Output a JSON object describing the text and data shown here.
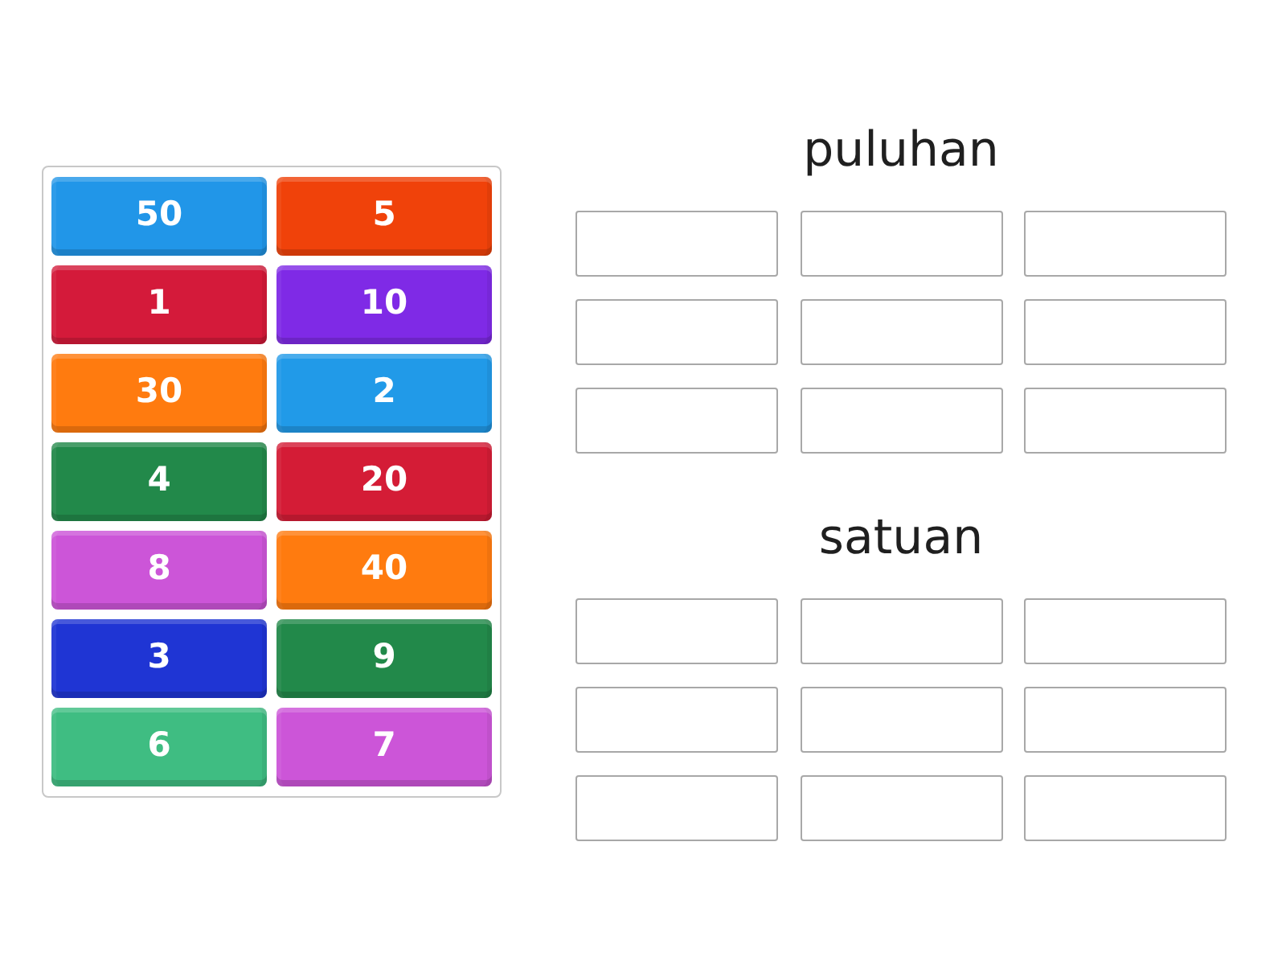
{
  "tiles": [
    {
      "label": "50",
      "color": "#2196e8"
    },
    {
      "label": "5",
      "color": "#f0420a"
    },
    {
      "label": "1",
      "color": "#d41a3a"
    },
    {
      "label": "10",
      "color": "#7f2ae6"
    },
    {
      "label": "30",
      "color": "#ff7b0f"
    },
    {
      "label": "2",
      "color": "#219ae8"
    },
    {
      "label": "4",
      "color": "#22894a"
    },
    {
      "label": "20",
      "color": "#d41c36"
    },
    {
      "label": "8",
      "color": "#cc55d8"
    },
    {
      "label": "40",
      "color": "#ff7b0f"
    },
    {
      "label": "3",
      "color": "#1f35d4"
    },
    {
      "label": "9",
      "color": "#22894a"
    },
    {
      "label": "6",
      "color": "#3fbd82"
    },
    {
      "label": "7",
      "color": "#cc55d8"
    }
  ],
  "groups": [
    {
      "title": "puluhan"
    },
    {
      "title": "satuan"
    }
  ]
}
